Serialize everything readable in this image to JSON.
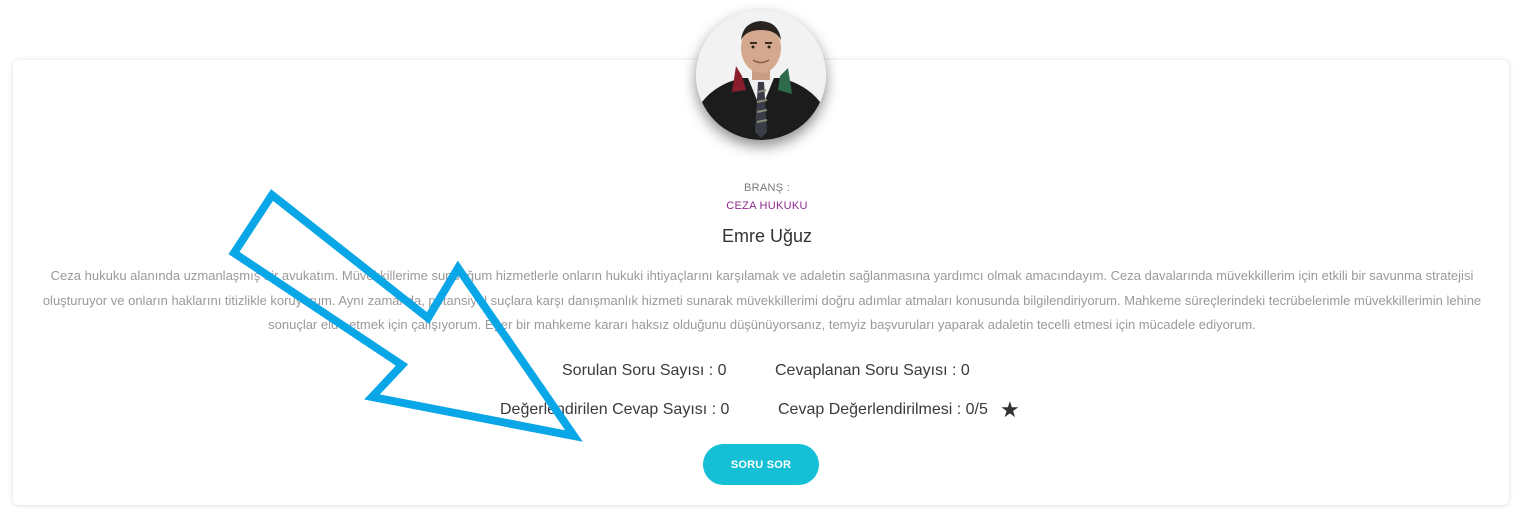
{
  "profile": {
    "branch_label": "BRANŞ :",
    "branch_value": "CEZA HUKUKU",
    "name": "Emre Uğuz",
    "bio": "Ceza hukuku alanında uzmanlaşmış bir avukatım. Müvekkillerime sunduğum hizmetlerle onların hukuki ihtiyaçlarını karşılamak ve adaletin sağlanmasına yardımcı olmak amacındayım. Ceza davalarında müvekkillerim için etkili bir savunma stratejisi oluşturuyor ve onların haklarını titizlikle koruyorum. Aynı zamanda, potansiyel suçlara karşı danışmanlık hizmeti sunarak müvekkillerimi doğru adımlar atmaları konusunda bilgilendiriyorum. Mahkeme süreçlerindeki tecrübelerimle müvekkillerimin lehine sonuçlar elde etmek için çalışıyorum. Eğer bir mahkeme kararı haksız olduğunu düşünüyorsanız, temyiz başvuruları yaparak adaletin tecelli etmesi için mücadele ediyorum."
  },
  "stats": {
    "asked": "Sorulan Soru Sayısı : 0",
    "answered": "Cevaplanan Soru Sayısı : 0",
    "rated_answers": "Değerlendirilen Cevap Sayısı : 0",
    "rating": "Cevap Değerlendirilmesi : 0/5",
    "rating_icon": "★"
  },
  "actions": {
    "ask_button": "SORU SOR"
  },
  "colors": {
    "accent_button": "#15bfd6",
    "branch": "#8e2a8e",
    "annotation_arrow": "#0aa7e8"
  },
  "icons": {
    "rating": "star-icon",
    "annotation": "arrow-annotation"
  }
}
